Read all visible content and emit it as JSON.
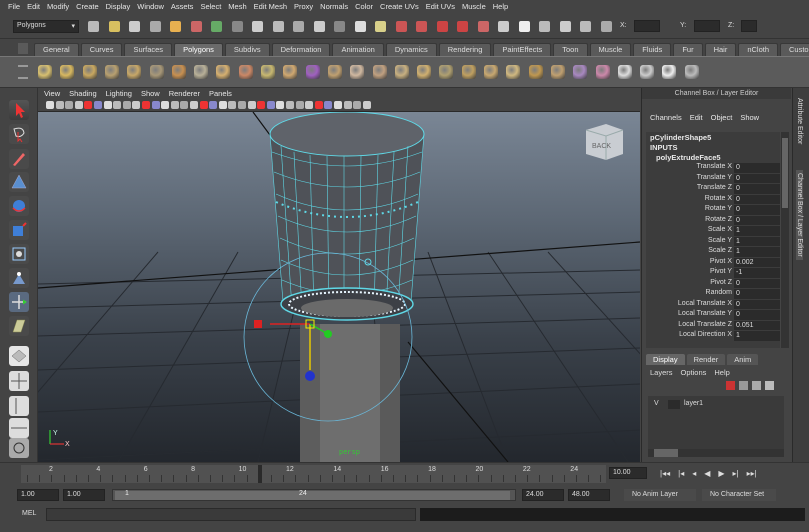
{
  "menubar": [
    "File",
    "Edit",
    "Modify",
    "Create",
    "Display",
    "Window",
    "Assets",
    "Select",
    "Mesh",
    "Edit Mesh",
    "Proxy",
    "Normals",
    "Color",
    "Create UVs",
    "Edit UVs",
    "Muscle",
    "Help"
  ],
  "status": {
    "mode": "Polygons",
    "x_label": "X:",
    "y_label": "Y:",
    "z_label": "Z:"
  },
  "shelf_tabs": [
    "General",
    "Curves",
    "Surfaces",
    "Polygons",
    "Subdivs",
    "Deformation",
    "Animation",
    "Dynamics",
    "Rendering",
    "PaintEffects",
    "Toon",
    "Muscle",
    "Fluids",
    "Fur",
    "Hair",
    "nCloth",
    "Custom"
  ],
  "shelf_active": "Polygons",
  "viewport": {
    "menu": [
      "View",
      "Shading",
      "Lighting",
      "Show",
      "Renderer",
      "Panels"
    ],
    "camera_label": "persp",
    "viewcube_label": "BACK",
    "axis_y": "Y",
    "axis_x": "X"
  },
  "channel_box": {
    "title": "Channel Box / Layer Editor",
    "menu": [
      "Channels",
      "Edit",
      "Object",
      "Show"
    ],
    "shape": "pCylinderShape5",
    "inputs": "INPUTS",
    "node": "polyExtrudeFace5",
    "rows": [
      {
        "name": "Translate X",
        "value": "0"
      },
      {
        "name": "Translate Y",
        "value": "0"
      },
      {
        "name": "Translate Z",
        "value": "0"
      },
      {
        "name": "Rotate X",
        "value": "0"
      },
      {
        "name": "Rotate Y",
        "value": "0"
      },
      {
        "name": "Rotate Z",
        "value": "0"
      },
      {
        "name": "Scale X",
        "value": "1"
      },
      {
        "name": "Scale Y",
        "value": "1"
      },
      {
        "name": "Scale Z",
        "value": "1"
      },
      {
        "name": "Pivot X",
        "value": "0.002"
      },
      {
        "name": "Pivot Y",
        "value": "-1"
      },
      {
        "name": "Pivot Z",
        "value": "0"
      },
      {
        "name": "Random",
        "value": "0"
      },
      {
        "name": "Local Translate X",
        "value": "0"
      },
      {
        "name": "Local Translate Y",
        "value": "0"
      },
      {
        "name": "Local Translate Z",
        "value": "0.051"
      },
      {
        "name": "Local Direction X",
        "value": "1"
      }
    ]
  },
  "layer_editor": {
    "tabs": [
      "Display",
      "Render",
      "Anim"
    ],
    "active_tab": "Display",
    "menu": [
      "Layers",
      "Options",
      "Help"
    ],
    "layer_v": "V",
    "layer_name": "layer1"
  },
  "side_tabs": [
    "Attribute Editor",
    "Channel Box / Layer Editor"
  ],
  "timeline": {
    "ticks": [
      "2",
      "4",
      "6",
      "8",
      "10",
      "12",
      "14",
      "16",
      "18",
      "20",
      "22",
      "24"
    ],
    "current_frame": "10.00"
  },
  "range": {
    "start": "1.00",
    "playback_start": "1.00",
    "slider_start": "1",
    "slider_end": "24",
    "playback_end": "24.00",
    "end": "48.00",
    "anim_layer": "No Anim Layer",
    "character_set": "No Character Set"
  },
  "command": {
    "label": "MEL"
  },
  "colors": {
    "selection": "#5fd8e6",
    "bg": "#444444"
  }
}
